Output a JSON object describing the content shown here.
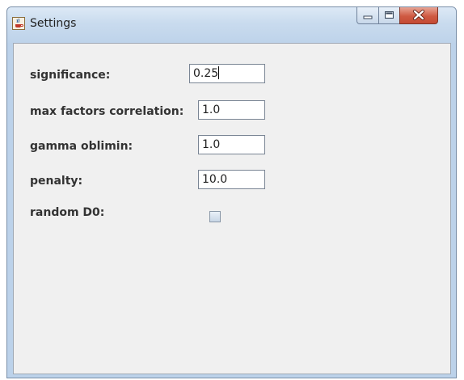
{
  "window": {
    "title": "Settings",
    "icon": "java-cup-icon",
    "controls": [
      "minimize-icon",
      "maximize-icon",
      "close-icon"
    ]
  },
  "form": {
    "significance_label": "significance:",
    "significance_value": "0.25",
    "max_factors_correlation_label": "max factors correlation:",
    "max_factors_correlation_value": "1.0",
    "gamma_oblimin_label": "gamma oblimin:",
    "gamma_oblimin_value": "1.0",
    "penalty_label": "penalty:",
    "penalty_value": "10.0",
    "random_d0_label": "random D0:",
    "random_d0_checked": false
  }
}
